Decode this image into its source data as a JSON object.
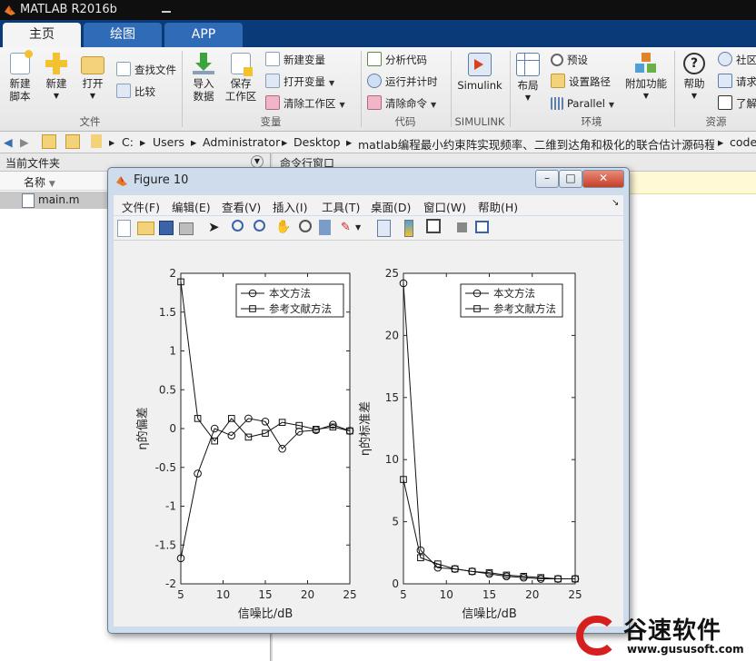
{
  "window": {
    "title": "MATLAB R2016b"
  },
  "tabs": [
    {
      "label": "主页"
    },
    {
      "label": "绘图"
    },
    {
      "label": "APP"
    }
  ],
  "ribbon": {
    "file": {
      "new_script": "新建\n脚本",
      "new": "新建",
      "open": "打开",
      "find_files": "查找文件",
      "compare": "比较",
      "group": "文件"
    },
    "variable": {
      "import": "导入\n数据",
      "save_ws": "保存\n工作区",
      "new_var": "新建变量",
      "open_var": "打开变量",
      "clear_ws": "清除工作区",
      "group": "变量"
    },
    "code": {
      "analyze": "分析代码",
      "run_time": "运行并计时",
      "clear_cmd": "清除命令",
      "group": "代码"
    },
    "simulink": {
      "label": "Simulink",
      "group": "SIMULINK"
    },
    "env": {
      "layout": "布局",
      "prefs": "预设",
      "set_path": "设置路径",
      "parallel": "Parallel",
      "addons": "附加功能",
      "group": "环境"
    },
    "resources": {
      "help": "帮助",
      "community": "社区",
      "request": "请求",
      "learn": "了解",
      "group": "资源"
    }
  },
  "address": {
    "crumbs": [
      "C:",
      "Users",
      "Administrator",
      "Desktop",
      "matlab编程最小约束阵实现频率、二维到达角和极化的联合估计源码程序",
      "code"
    ]
  },
  "left_panel": {
    "title": "当前文件夹",
    "col_name": "名称",
    "file": "main.m"
  },
  "right_panel": {
    "title": "命令行窗口"
  },
  "figure": {
    "title": "Figure 10",
    "menu": [
      "文件(F)",
      "编辑(E)",
      "查看(V)",
      "插入(I)",
      "工具(T)",
      "桌面(D)",
      "窗口(W)",
      "帮助(H)"
    ]
  },
  "chart_data": [
    {
      "type": "line",
      "ylabel": "η的偏差",
      "xlabel": "信噪比/dB",
      "xlim": [
        5,
        25
      ],
      "ylim": [
        -2,
        2
      ],
      "xticks": [
        5,
        10,
        15,
        20,
        25
      ],
      "yticks": [
        -2,
        -1.5,
        -1,
        -0.5,
        0,
        0.5,
        1,
        1.5,
        2
      ],
      "legend_position": "top-right",
      "x": [
        5,
        7,
        9,
        11,
        13,
        15,
        17,
        19,
        21,
        23,
        25
      ],
      "series": [
        {
          "name": "本文方法",
          "marker": "circle",
          "values": [
            -1.67,
            -0.58,
            0.0,
            -0.09,
            0.13,
            0.09,
            -0.26,
            -0.04,
            -0.02,
            0.05,
            -0.03
          ]
        },
        {
          "name": "参考文献方法",
          "marker": "square",
          "values": [
            1.89,
            0.13,
            -0.16,
            0.13,
            -0.11,
            -0.06,
            0.08,
            0.04,
            -0.01,
            0.02,
            -0.03
          ]
        }
      ]
    },
    {
      "type": "line",
      "ylabel": "η的标准差",
      "xlabel": "信噪比/dB",
      "xlim": [
        5,
        25
      ],
      "ylim": [
        0,
        25
      ],
      "xticks": [
        5,
        10,
        15,
        20,
        25
      ],
      "yticks": [
        0,
        5,
        10,
        15,
        20,
        25
      ],
      "legend_position": "top-right",
      "x": [
        5,
        7,
        9,
        11,
        13,
        15,
        17,
        19,
        21,
        23,
        25
      ],
      "series": [
        {
          "name": "本文方法",
          "marker": "circle",
          "values": [
            24.2,
            2.7,
            1.3,
            1.2,
            1.0,
            0.8,
            0.6,
            0.5,
            0.4,
            0.4,
            0.4
          ]
        },
        {
          "name": "参考文献方法",
          "marker": "square",
          "values": [
            8.4,
            2.1,
            1.6,
            1.2,
            1.0,
            0.9,
            0.7,
            0.6,
            0.5,
            0.4,
            0.4
          ]
        }
      ]
    }
  ],
  "watermark": {
    "brand": "谷速软件",
    "url": "www.gususoft.com"
  },
  "colors": {
    "tab_bar": "#0b3a78",
    "active_tab": "#f4f4f4",
    "figure_frame": "#cfdcec"
  }
}
